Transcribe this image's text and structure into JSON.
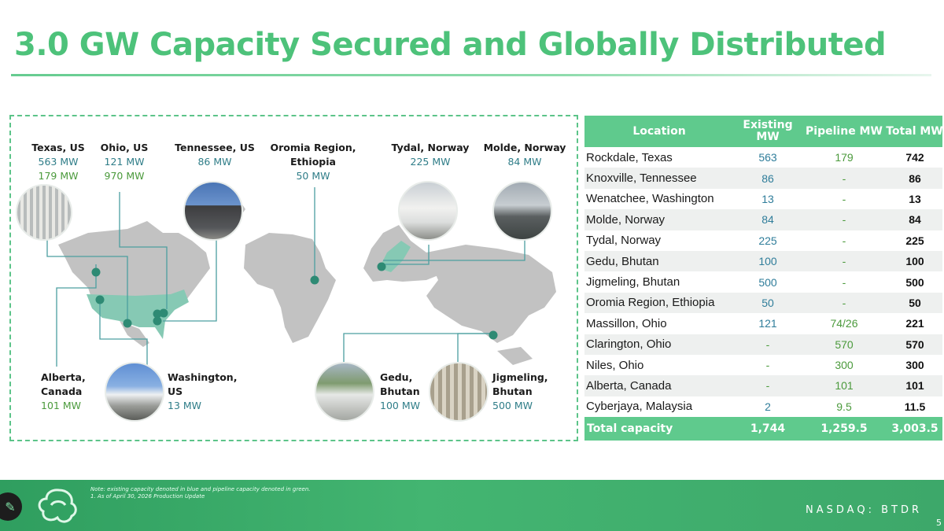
{
  "title": "3.0 GW Capacity Secured and Globally Distributed",
  "map_labels": {
    "texas": {
      "name": "Texas, US",
      "existing": "563 MW",
      "pipeline": "179 MW"
    },
    "ohio": {
      "name": "Ohio, US",
      "existing": "121 MW",
      "pipeline": "970 MW"
    },
    "tennessee": {
      "name": "Tennessee, US",
      "existing": "86 MW"
    },
    "oromia": {
      "name1": "Oromia Region,",
      "name2": "Ethiopia",
      "existing": "50 MW"
    },
    "tydal": {
      "name": "Tydal, Norway",
      "existing": "225 MW"
    },
    "molde": {
      "name": "Molde, Norway",
      "existing": "84 MW"
    },
    "alberta": {
      "name1": "Alberta,",
      "name2": "Canada",
      "pipeline": "101 MW"
    },
    "washington": {
      "name1": "Washington,",
      "name2": "US",
      "existing": "13 MW"
    },
    "gedu": {
      "name1": "Gedu,",
      "name2": "Bhutan",
      "existing": "100 MW"
    },
    "jigmeling": {
      "name1": "Jigmeling,",
      "name2": "Bhutan",
      "existing": "500 MW"
    }
  },
  "table": {
    "headers": {
      "location": "Location",
      "existing": "Existing MW",
      "pipeline": "Pipeline MW",
      "total": "Total MW"
    },
    "rows": [
      {
        "location": "Rockdale, Texas",
        "existing": "563",
        "pipeline": "179",
        "total": "742"
      },
      {
        "location": "Knoxville, Tennessee",
        "existing": "86",
        "pipeline": "-",
        "total": "86"
      },
      {
        "location": "Wenatchee, Washington",
        "existing": "13",
        "pipeline": "-",
        "total": "13"
      },
      {
        "location": "Molde, Norway",
        "existing": "84",
        "pipeline": "-",
        "total": "84"
      },
      {
        "location": "Tydal, Norway",
        "existing": "225",
        "pipeline": "-",
        "total": "225"
      },
      {
        "location": "Gedu, Bhutan",
        "existing": "100",
        "pipeline": "-",
        "total": "100"
      },
      {
        "location": "Jigmeling, Bhutan",
        "existing": "500",
        "pipeline": "-",
        "total": "500"
      },
      {
        "location": "Oromia Region, Ethiopia",
        "existing": "50",
        "pipeline": "-",
        "total": "50"
      },
      {
        "location": "Massillon, Ohio",
        "existing": "121",
        "pipeline": "74/26",
        "total": "221"
      },
      {
        "location": "Clarington, Ohio",
        "existing": "-",
        "pipeline": "570",
        "total": "570"
      },
      {
        "location": "Niles, Ohio",
        "existing": "-",
        "pipeline": "300",
        "total": "300"
      },
      {
        "location": "Alberta, Canada",
        "existing": "-",
        "pipeline": "101",
        "total": "101"
      },
      {
        "location": "Cyberjaya, Malaysia",
        "existing": "2",
        "pipeline": "9.5",
        "total": "11.5"
      }
    ],
    "footer": {
      "label": "Total capacity",
      "existing": "1,744",
      "pipeline": "1,259.5",
      "total": "3,003.5"
    }
  },
  "footnote": {
    "note": "Note: existing capacity denoted in blue and pipeline capacity denoted in green.",
    "item": "1.     As of April 30, 2026 Production Update"
  },
  "ticker": "NASDAQ: BTDR",
  "page_number": "5",
  "colors": {
    "accent": "#4dc27a",
    "existing": "#2f7d88",
    "pipeline": "#4b9a3c",
    "footer": "#3da86a"
  }
}
